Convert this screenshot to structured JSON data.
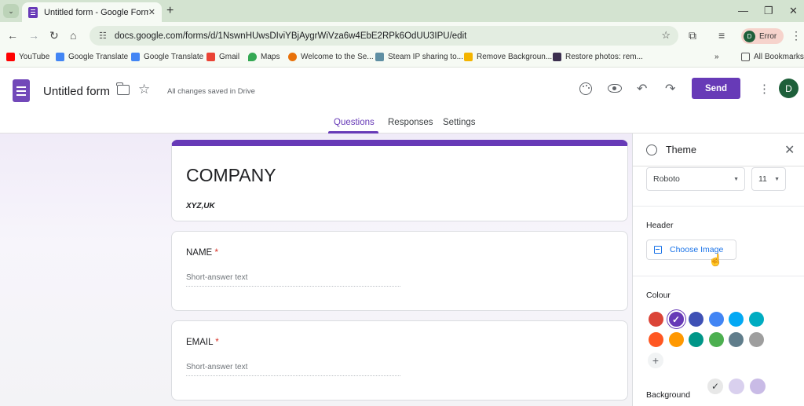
{
  "browser": {
    "tab_title": "Untitled form - Google Forms",
    "url": "docs.google.com/forms/d/1NswnHUwsDIviYBjAygrWiVza6w4EbE2RPk6OdUU3IPU/edit",
    "profile_initial": "D",
    "profile_status": "Error",
    "bookmarks": [
      {
        "label": "YouTube",
        "color": "#ff0000"
      },
      {
        "label": "Google Translate",
        "color": "#4285f4"
      },
      {
        "label": "Google Translate",
        "color": "#4285f4"
      },
      {
        "label": "Gmail",
        "color": "#ea4335"
      },
      {
        "label": "Maps",
        "color": "#34a853"
      },
      {
        "label": "Welcome to the Se...",
        "color": "#e8710a"
      },
      {
        "label": "Steam IP sharing to...",
        "color": "#5f8fa3"
      },
      {
        "label": "Remove Backgroun...",
        "color": "#f4b400"
      },
      {
        "label": "Restore photos: rem...",
        "color": "#3c2f4f"
      }
    ],
    "all_bookmarks": "All Bookmarks"
  },
  "app": {
    "form_title": "Untitled form",
    "save_status": "All changes saved in Drive",
    "send_label": "Send",
    "account_initial": "D",
    "tabs": [
      "Questions",
      "Responses",
      "Settings"
    ]
  },
  "form": {
    "title": "COMPANY",
    "description": "XYZ,UK",
    "questions": [
      {
        "label": "NAME",
        "required_mark": "*",
        "hint": "Short-answer text"
      },
      {
        "label": "EMAIL",
        "required_mark": "*",
        "hint": "Short-answer text"
      }
    ]
  },
  "theme": {
    "title": "Theme",
    "font": "Roboto",
    "font_size": "11",
    "header_label": "Header",
    "choose_image": "Choose Image",
    "colour_label": "Colour",
    "colours": [
      "#db4437",
      "#673ab7",
      "#3f51b5",
      "#4285f4",
      "#03a9f4",
      "#00acc1",
      "#ff5722",
      "#ff9800",
      "#009688",
      "#4caf50",
      "#607d8b",
      "#9e9e9e"
    ],
    "selected_colour": "#673ab7",
    "background_label": "Background",
    "backgrounds": [
      "#e8e8e8",
      "#d9d0ee",
      "#c9bbe6"
    ]
  }
}
